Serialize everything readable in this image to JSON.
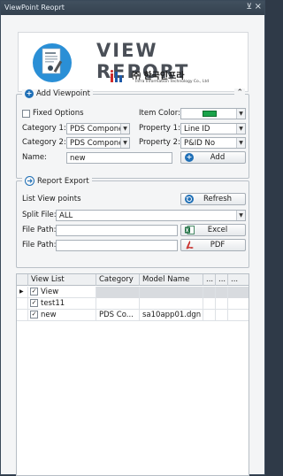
{
  "window": {
    "title": "ViewPoint Reoprt",
    "pin_icon": "pin-icon",
    "close_icon": "close-icon"
  },
  "logo": {
    "main": "VIEW REPORT",
    "korean": "㈜ 한국인프라",
    "english": "Infra Information Technology Co., Ltd"
  },
  "add_viewpoint": {
    "title": "Add Viewpoint",
    "fixed_options_label": "Fixed Options",
    "fixed_options_checked": false,
    "item_color_label": "Item Color:",
    "item_color": "#1aa34a",
    "category1_label": "Category 1:",
    "category1_value": "PDS Component",
    "category2_label": "Category 2:",
    "category2_value": "PDS Component",
    "property1_label": "Property 1:",
    "property1_value": "Line ID",
    "property2_label": "Property 2:",
    "property2_value": "P&ID No",
    "name_label": "Name:",
    "name_value": "new",
    "add_button": "Add"
  },
  "report_export": {
    "title": "Report Export",
    "list_label": "List View points",
    "refresh_button": "Refresh",
    "split_label": "Split File:",
    "split_value": "ALL",
    "file_path_label_1": "File Path:",
    "file_path_value_1": "",
    "excel_button": "Excel",
    "file_path_label_2": "File Path:",
    "file_path_value_2": "",
    "pdf_button": "PDF"
  },
  "grid": {
    "columns": [
      "View List",
      "Category",
      "Model Name",
      "...",
      "...",
      "..."
    ],
    "rows": [
      {
        "checked": true,
        "name": "View",
        "category": "",
        "model": "",
        "current": true
      },
      {
        "checked": true,
        "name": "test11",
        "category": "",
        "model": "",
        "current": false
      },
      {
        "checked": true,
        "name": "new",
        "category": "PDS Co...",
        "model": "sa10app01.dgn",
        "current": false
      }
    ]
  }
}
